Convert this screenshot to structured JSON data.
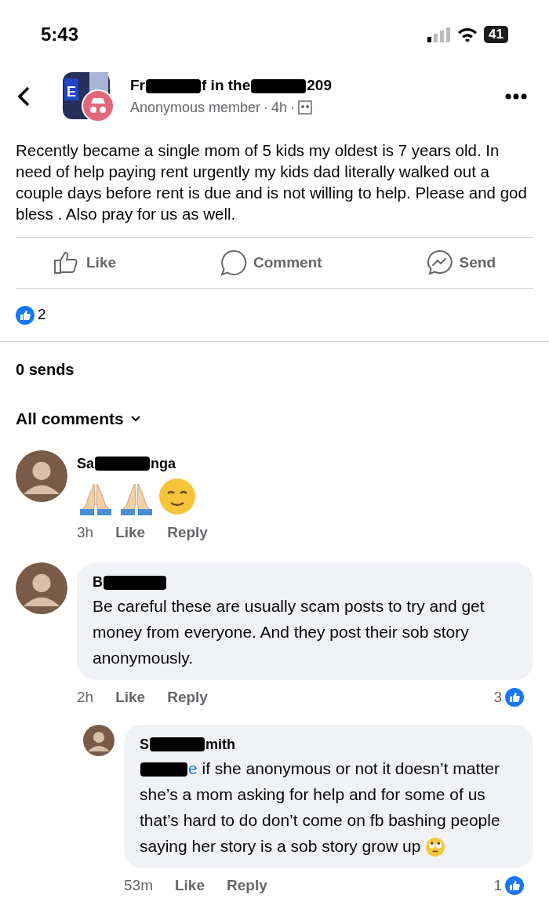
{
  "status_bar": {
    "time": "5:43",
    "battery": "41"
  },
  "post": {
    "logo_letter": "E",
    "separator": "·",
    "group_name_parts": [
      "Fr",
      "f in the",
      "209"
    ],
    "author": "Anonymous member",
    "time": "4h",
    "text": "Recently became a single mom of 5 kids my oldest is 7 years old. In need of help paying rent urgently my kids dad literally walked out a couple days before rent is due and is not willing to help. Please and god bless . Also pray for us as well."
  },
  "actions": [
    {
      "kind": "like",
      "label": "Like"
    },
    {
      "kind": "comment",
      "label": "Comment"
    },
    {
      "kind": "send",
      "label": "Send"
    }
  ],
  "reactions": {
    "count": "2"
  },
  "sends": "0 sends",
  "comments_header": "All comments",
  "comments": [
    {
      "name_parts": [
        "Sa",
        "nga"
      ],
      "kind": "emoji",
      "time": "3h",
      "like": "Like",
      "reply": "Reply"
    },
    {
      "name_parts": [
        "B"
      ],
      "kind": "text",
      "text": "Be careful these are usually scam posts to try and get money from everyone. And they post their sob story anonymously.",
      "time": "2h",
      "like": "Like",
      "reply": "Reply",
      "likes": "3",
      "replies": [
        {
          "name_parts": [
            "S",
            "mith"
          ],
          "kind": "text",
          "mention": "e",
          "text": " if she anonymous or not it doesn’t matter she’s a mom asking for help and for some of us that’s hard to do don’t come on fb bashing people saying her story is a sob story grow up",
          "trailing_emoji": true,
          "time": "53m",
          "like": "Like",
          "reply": "Reply",
          "likes": "1"
        }
      ]
    }
  ]
}
